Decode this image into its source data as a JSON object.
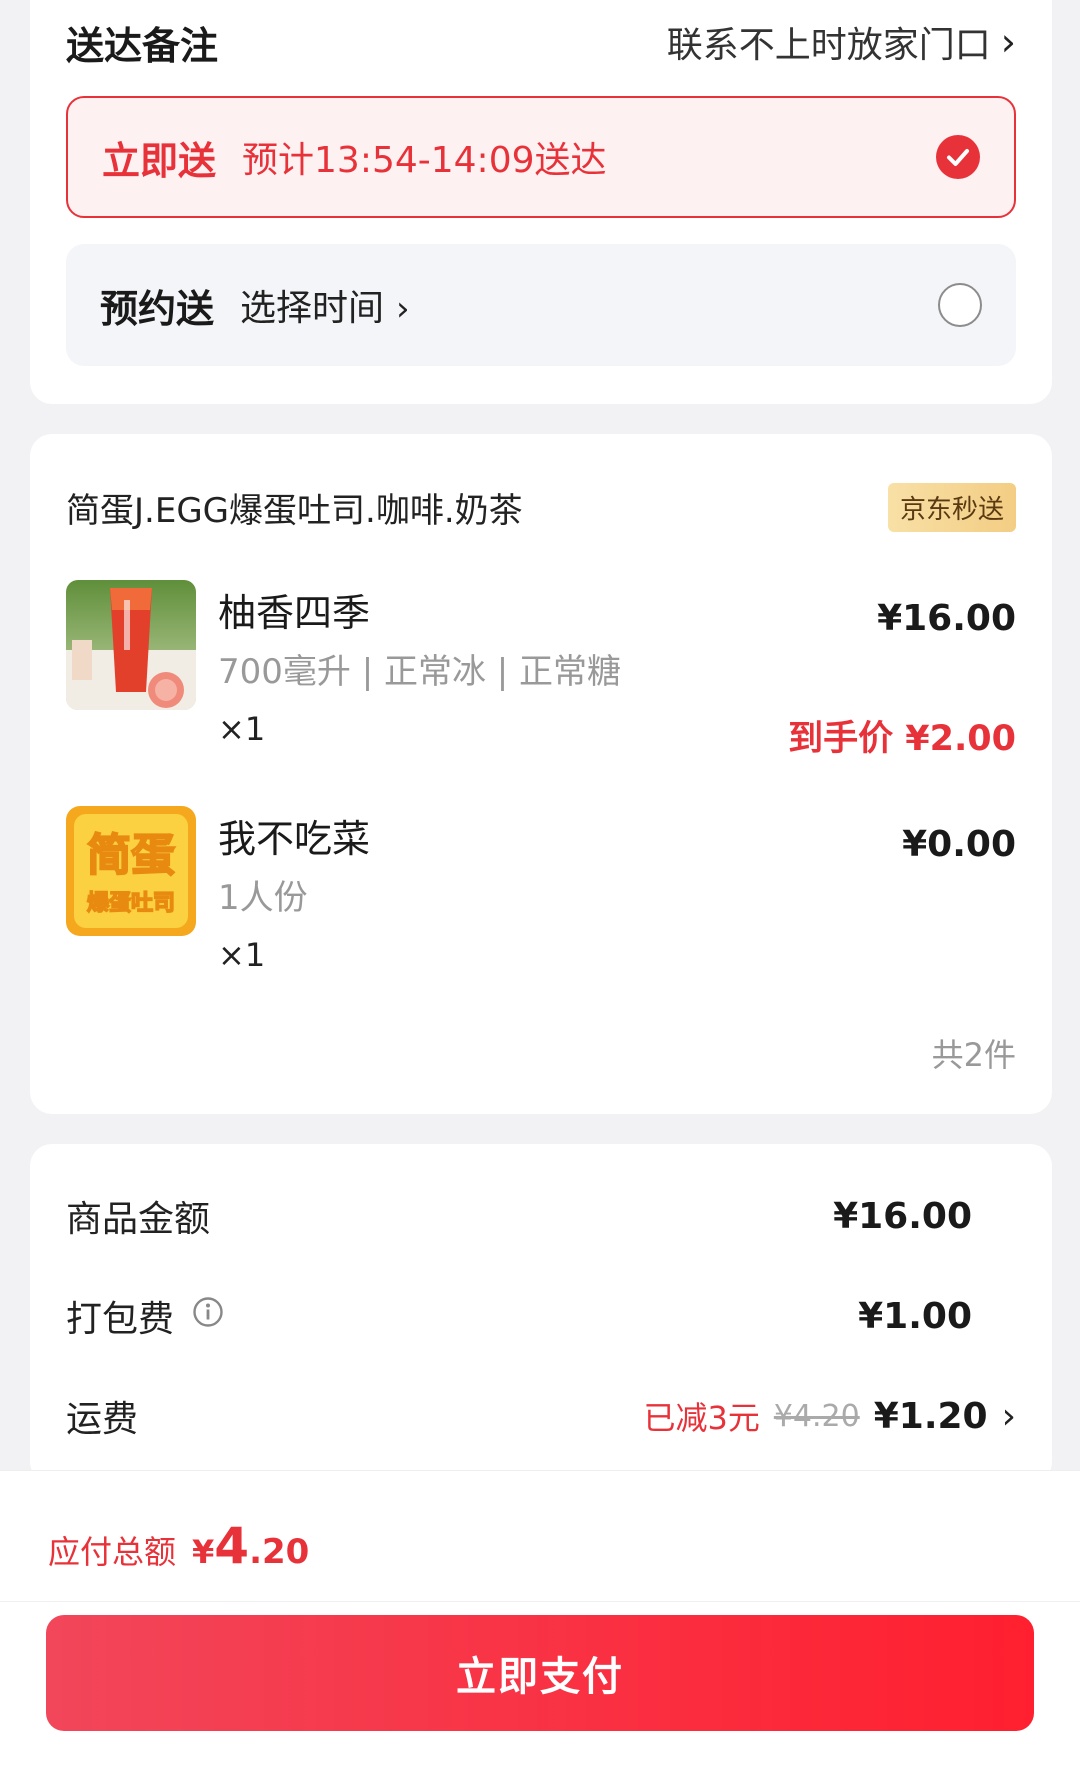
{
  "delivery": {
    "remark_title": "送达备注",
    "remark_value": "联系不上时放家门口",
    "chevron": "›",
    "options": [
      {
        "title": "立即送",
        "subtitle": "预计13:54-14:09送达",
        "selected": true,
        "icon": "check-icon"
      },
      {
        "title": "预约送",
        "subtitle": "选择时间",
        "selected": false,
        "icon": "radio-empty-icon"
      }
    ]
  },
  "order": {
    "store_name": "简蛋J.EGG爆蛋吐司.咖啡.奶茶",
    "badge": "京东秒送",
    "items": [
      {
        "name": "柚香四季",
        "spec": "700毫升 | 正常冰 | 正常糖",
        "qty": "×1",
        "price": "¥16.00",
        "final_price": "到手价 ¥2.00"
      },
      {
        "name": "我不吃菜",
        "spec": "1人份",
        "qty": "×1",
        "price": "¥0.00",
        "final_price": ""
      }
    ],
    "logo_text_top": "简蛋",
    "logo_text_bottom": "爆蛋吐司",
    "total_count": "共2件"
  },
  "summary": {
    "goods_label": "商品金额",
    "goods_value": "¥16.00",
    "packing_label": "打包费",
    "packing_value": "¥1.00",
    "shipping_label": "运费",
    "shipping_discount": "已减3元",
    "shipping_original": "¥4.20",
    "shipping_value": "¥1.20"
  },
  "footer": {
    "total_label": "应付总额",
    "total_currency": "¥",
    "total_int": "4",
    "total_dec": ".20",
    "pay_button": "立即支付"
  },
  "colors": {
    "accent_red": "#e8323a",
    "badge_gold": "#f3cd83",
    "background": "#f2f2f4"
  }
}
